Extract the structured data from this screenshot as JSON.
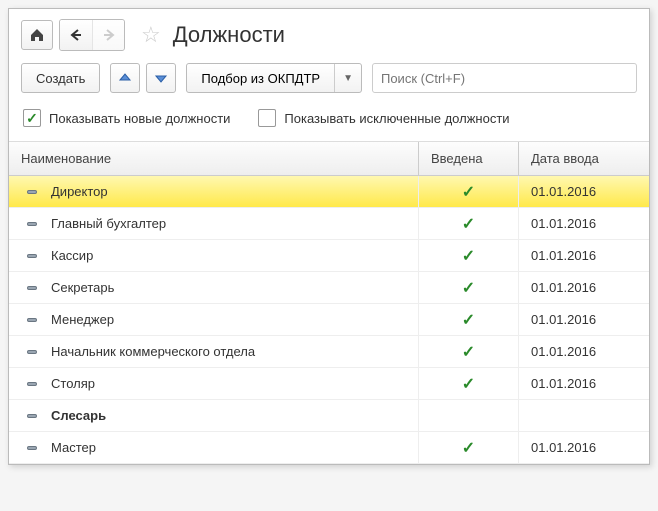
{
  "title": "Должности",
  "toolbar": {
    "create_label": "Создать",
    "pick_label": "Подбор из ОКПДТР"
  },
  "search": {
    "placeholder": "Поиск (Ctrl+F)"
  },
  "filters": {
    "show_new_label": "Показывать новые должности",
    "show_new_checked": true,
    "show_excluded_label": "Показывать исключенные должности",
    "show_excluded_checked": false
  },
  "columns": {
    "name": "Наименование",
    "intro": "Введена",
    "date": "Дата ввода"
  },
  "rows": [
    {
      "name": "Директор",
      "intro": true,
      "date": "01.01.2016",
      "selected": true,
      "bold": false
    },
    {
      "name": "Главный бухгалтер",
      "intro": true,
      "date": "01.01.2016",
      "selected": false,
      "bold": false
    },
    {
      "name": "Кассир",
      "intro": true,
      "date": "01.01.2016",
      "selected": false,
      "bold": false
    },
    {
      "name": "Секретарь",
      "intro": true,
      "date": "01.01.2016",
      "selected": false,
      "bold": false
    },
    {
      "name": "Менеджер",
      "intro": true,
      "date": "01.01.2016",
      "selected": false,
      "bold": false
    },
    {
      "name": "Начальник коммерческого отдела",
      "intro": true,
      "date": "01.01.2016",
      "selected": false,
      "bold": false
    },
    {
      "name": "Столяр",
      "intro": true,
      "date": "01.01.2016",
      "selected": false,
      "bold": false
    },
    {
      "name": "Слесарь",
      "intro": false,
      "date": "",
      "selected": false,
      "bold": true
    },
    {
      "name": "Мастер",
      "intro": true,
      "date": "01.01.2016",
      "selected": false,
      "bold": false
    }
  ]
}
